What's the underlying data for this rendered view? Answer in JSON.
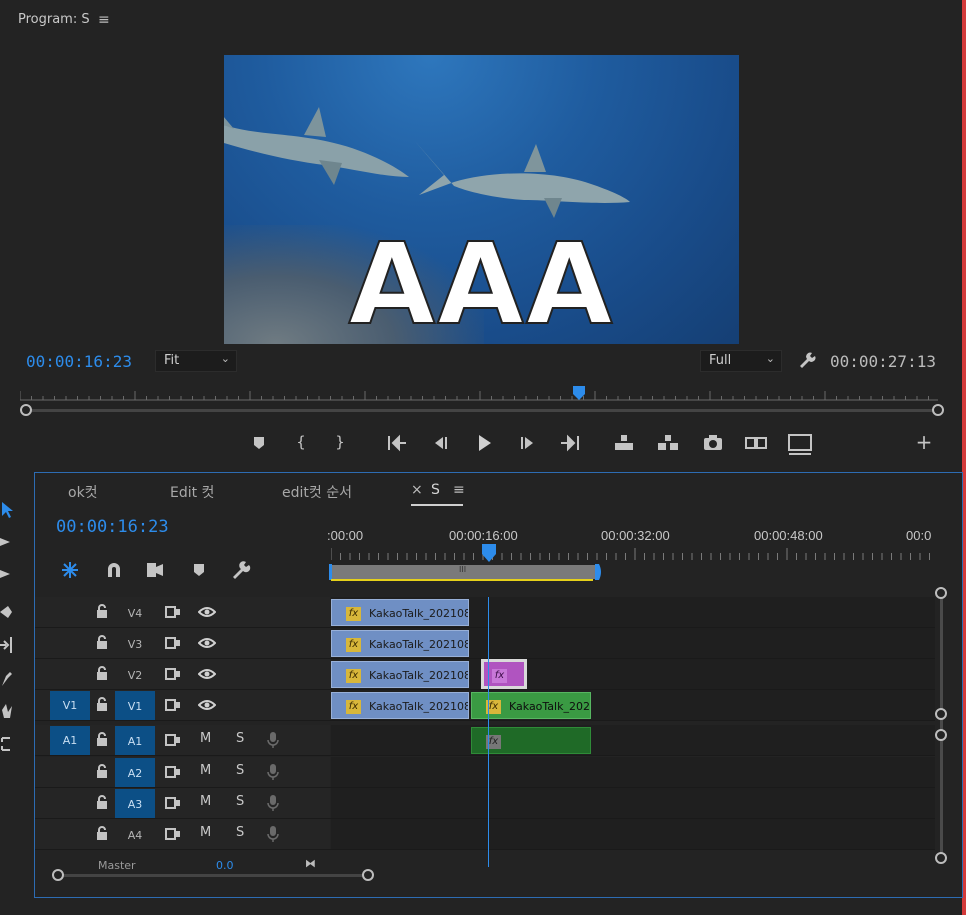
{
  "program": {
    "title": "Program: S",
    "menu_glyph": "≡",
    "timecode_current": "00:00:16:23",
    "timecode_duration": "00:00:27:13",
    "fit_label": "Fit",
    "resolution_label": "Full",
    "overlay_text": "AAA",
    "playhead_fraction": 0.606
  },
  "transport": {
    "mark_glyph": "⬛",
    "in_glyph": "{",
    "out_glyph": "}",
    "add_glyph": "+"
  },
  "timeline": {
    "tabs": [
      "ok컷",
      "Edit 컷",
      "edit컷 순서",
      "S"
    ],
    "close_glyph": "×",
    "menu_glyph": "≡",
    "timecode": "00:00:16:23",
    "ruler_labels": [
      ":00:00",
      "00:00:16:00",
      "00:00:32:00",
      "00:00:48:00",
      "00:0"
    ],
    "work_area_marker": "III",
    "video_tracks": [
      {
        "name": "V4",
        "clips": [
          {
            "label": "KakaoTalk_202108",
            "color": "#6f8fc4"
          }
        ]
      },
      {
        "name": "V3",
        "clips": [
          {
            "label": "KakaoTalk_202108",
            "color": "#6f8fc4"
          }
        ]
      },
      {
        "name": "V2",
        "clips": [
          {
            "label": "KakaoTalk_202108",
            "color": "#6f8fc4"
          },
          {
            "label": "",
            "color": "#b054c0"
          }
        ]
      },
      {
        "name": "V1",
        "source_patch": "V1",
        "clips": [
          {
            "label": "KakaoTalk_202108",
            "color": "#6f8fc4"
          },
          {
            "label": "KakaoTalk_202",
            "color": "#3a9a43"
          }
        ]
      }
    ],
    "audio_tracks": [
      {
        "name": "A1",
        "source_patch": "A1",
        "mute": "M",
        "solo": "S"
      },
      {
        "name": "A2",
        "mute": "M",
        "solo": "S"
      },
      {
        "name": "A3",
        "mute": "M",
        "solo": "S"
      },
      {
        "name": "A4",
        "mute": "M",
        "solo": "S"
      }
    ],
    "master_label": "Master",
    "master_value": "0.0",
    "fx_glyph": "fx"
  },
  "colors": {
    "accent_blue": "#2d8ceb",
    "patch_blue": "#0c4f86",
    "clip_blue": "#6f8fc4",
    "clip_green": "#3a9a43",
    "work_area_yellow": "#e5d01a"
  }
}
